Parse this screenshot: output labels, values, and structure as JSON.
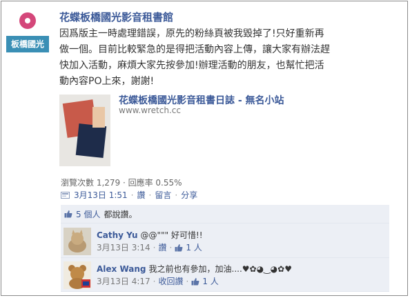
{
  "page": {
    "name": "花蝶板橋國光影音租書館",
    "avatar_label": "板橋國光"
  },
  "post": {
    "message": "因爲版主一時處理錯誤，原先的粉絲頁被我毀掉了!只好重新再\n做一個。目前比較緊急的是得把活動內容上傳，讓大家有辦法趕\n快加入活動，麻煩大家先按參加!辦理活動的朋友，也幫忙把活\n動內容PO上來，謝謝!",
    "attachment": {
      "title": "花蝶板橋國光影音租書日誌 - 無名小站",
      "url": "www.wretch.cc"
    },
    "stats": "瀏覽次數 1,279 · 回應率 0.55%",
    "date": "3月13日 1:51",
    "actions": [
      "讚",
      "留言",
      "分享"
    ]
  },
  "feedback": {
    "likes_count": "5 個人",
    "likes_suffix": "都說讚。",
    "comments": [
      {
        "author": "Cathy Yu",
        "text": "@@\"\"\" 好可惜!!",
        "date": "3月13日 3:14",
        "action": "讚",
        "likes": "1 人"
      },
      {
        "author": "Alex Wang",
        "text": "我之前也有參加，加油....♥✿◕‿◕✿♥",
        "date": "3月13日 4:17",
        "action": "收回讚",
        "likes": "1 人"
      }
    ]
  },
  "colors": {
    "link": "#3b5998",
    "feedback_bg": "#eceff5",
    "avatar_band": "#3a8fb5"
  }
}
